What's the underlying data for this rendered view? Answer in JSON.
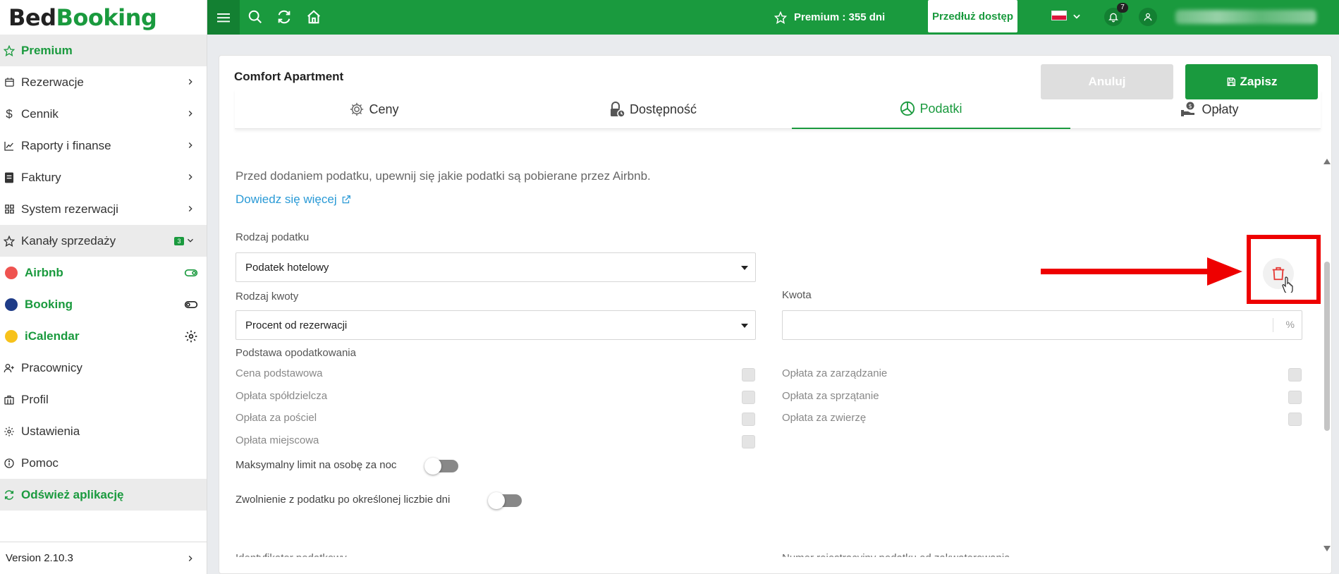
{
  "app": {
    "logo_part1": "Bed",
    "logo_part2": "Booking",
    "version": "Version 2.10.3"
  },
  "sidebar": {
    "premium": "Premium",
    "items": [
      {
        "label": "Rezerwacje"
      },
      {
        "label": "Cennik"
      },
      {
        "label": "Raporty i finanse"
      },
      {
        "label": "Faktury"
      },
      {
        "label": "System rezerwacji"
      }
    ],
    "channels": {
      "label": "Kanały sprzedaży",
      "badge": "3"
    },
    "channel_items": [
      {
        "label": "Airbnb",
        "color": "#ef5350"
      },
      {
        "label": "Booking",
        "color": "#1f3c88"
      },
      {
        "label": "iCalendar",
        "color": "#f7c21b"
      }
    ],
    "items2": [
      {
        "label": "Pracownicy"
      },
      {
        "label": "Profil"
      },
      {
        "label": "Ustawienia"
      },
      {
        "label": "Pomoc"
      }
    ],
    "refresh": "Odśwież aplikację"
  },
  "topbar": {
    "premium_status": "Premium : 355 dni",
    "extend_button": "Przedłuż dostęp",
    "notification_count": "7"
  },
  "card": {
    "title": "Comfort Apartment",
    "cancel": "Anuluj",
    "save": "Zapisz",
    "tabs": [
      "Ceny",
      "Dostępność",
      "Podatki",
      "Opłaty"
    ],
    "active_tab": "Podatki"
  },
  "form": {
    "info_text": "Przed dodaniem podatku, upewnij się jakie podatki są pobierane przez Airbnb.",
    "learn_more": "Dowiedz się więcej",
    "tax_type_label": "Rodzaj podatku",
    "tax_type_value": "Podatek hotelowy",
    "amount_type_label": "Rodzaj kwoty",
    "amount_type_value": "Procent od rezerwacji",
    "amount_label": "Kwota",
    "amount_unit": "%",
    "basis_label": "Podstawa opodatkowania",
    "basis_left": [
      "Cena podstawowa",
      "Opłata spółdzielcza",
      "Opłata za pościel",
      "Opłata miejscowa"
    ],
    "basis_right": [
      "Opłata za zarządzanie",
      "Opłata za sprzątanie",
      "Opłata za zwierzę"
    ],
    "max_limit_label": "Maksymalny limit na osobę za noc",
    "exemption_label": "Zwolnienie z podatku po określonej liczbie dni",
    "bottom_left_label": "Identyfikator podatkowy",
    "bottom_right_label": "Numer rejestracyjny podatku od zakwaterowania"
  },
  "colors": {
    "brand": "#1a9a3e",
    "annotation": "#ee0000",
    "delete": "#e53935"
  }
}
